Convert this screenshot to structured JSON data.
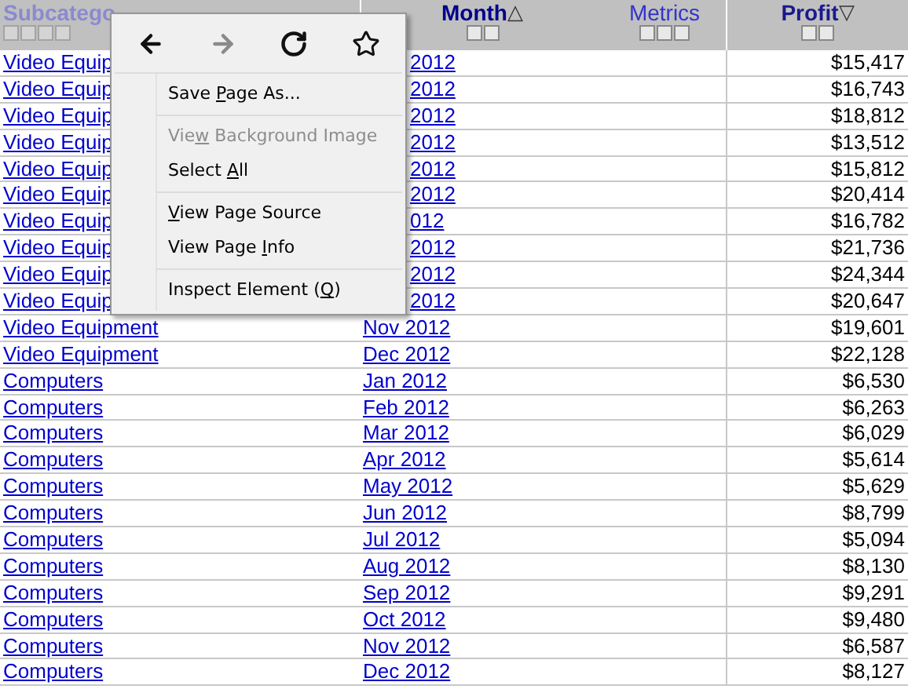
{
  "columns": [
    {
      "label": "Subcatego"
    },
    {
      "label": "Month",
      "sort_mark": "△"
    },
    {
      "label": "Metrics"
    },
    {
      "label": "Profit",
      "sort_mark": "▽"
    }
  ],
  "rows": [
    {
      "subcategory": "Video Equip",
      "month": "2012",
      "profit": "$15,417"
    },
    {
      "subcategory": "Video Equip",
      "month": "2012",
      "profit": "$16,743"
    },
    {
      "subcategory": "Video Equip",
      "month": "2012",
      "profit": "$18,812"
    },
    {
      "subcategory": "Video Equip",
      "month": "2012",
      "profit": "$13,512"
    },
    {
      "subcategory": "Video Equip",
      "month": "2012",
      "profit": "$15,812"
    },
    {
      "subcategory": "Video Equip",
      "month": "2012",
      "profit": "$20,414"
    },
    {
      "subcategory": "Video Equip",
      "month": "012",
      "profit": "$16,782"
    },
    {
      "subcategory": "Video Equip",
      "month": "2012",
      "profit": "$21,736"
    },
    {
      "subcategory": "Video Equip",
      "month": "2012",
      "profit": "$24,344"
    },
    {
      "subcategory": "Video Equip",
      "month": "2012",
      "profit": "$20,647"
    },
    {
      "subcategory": "Video Equipment",
      "month": "Nov 2012",
      "profit": "$19,601"
    },
    {
      "subcategory": "Video Equipment",
      "month": "Dec 2012",
      "profit": "$22,128"
    },
    {
      "subcategory": "Computers",
      "month": "Jan 2012",
      "profit": "$6,530"
    },
    {
      "subcategory": "Computers",
      "month": "Feb 2012",
      "profit": "$6,263"
    },
    {
      "subcategory": "Computers",
      "month": "Mar 2012",
      "profit": "$6,029"
    },
    {
      "subcategory": "Computers",
      "month": "Apr 2012",
      "profit": "$5,614"
    },
    {
      "subcategory": "Computers",
      "month": "May 2012",
      "profit": "$5,629"
    },
    {
      "subcategory": "Computers",
      "month": "Jun 2012",
      "profit": "$8,799"
    },
    {
      "subcategory": "Computers",
      "month": "Jul 2012",
      "profit": "$5,094"
    },
    {
      "subcategory": "Computers",
      "month": "Aug 2012",
      "profit": "$8,130"
    },
    {
      "subcategory": "Computers",
      "month": "Sep 2012",
      "profit": "$9,291"
    },
    {
      "subcategory": "Computers",
      "month": "Oct 2012",
      "profit": "$9,480"
    },
    {
      "subcategory": "Computers",
      "month": "Nov 2012",
      "profit": "$6,587"
    },
    {
      "subcategory": "Computers",
      "month": "Dec 2012",
      "profit": "$8,127"
    }
  ],
  "context_menu": {
    "nav": [
      {
        "kind": "back",
        "disabled": false
      },
      {
        "kind": "forward",
        "disabled": true
      },
      {
        "kind": "reload",
        "disabled": false
      },
      {
        "kind": "bookmark",
        "disabled": false
      }
    ],
    "sections": [
      [
        {
          "before": "Save ",
          "access_key": "P",
          "after": "age As...",
          "disabled": false
        }
      ],
      [
        {
          "before": "Vie",
          "access_key": "w",
          "after": " Background Image",
          "disabled": true
        },
        {
          "before": "Select ",
          "access_key": "A",
          "after": "ll",
          "disabled": false
        }
      ],
      [
        {
          "access_key": "V",
          "after": "iew Page Source",
          "disabled": false
        },
        {
          "before": "View Page ",
          "access_key": "I",
          "after": "nfo",
          "disabled": false
        }
      ],
      [
        {
          "before": "Inspect Element (",
          "access_key": "Q",
          "after": ")",
          "disabled": false
        }
      ]
    ]
  }
}
